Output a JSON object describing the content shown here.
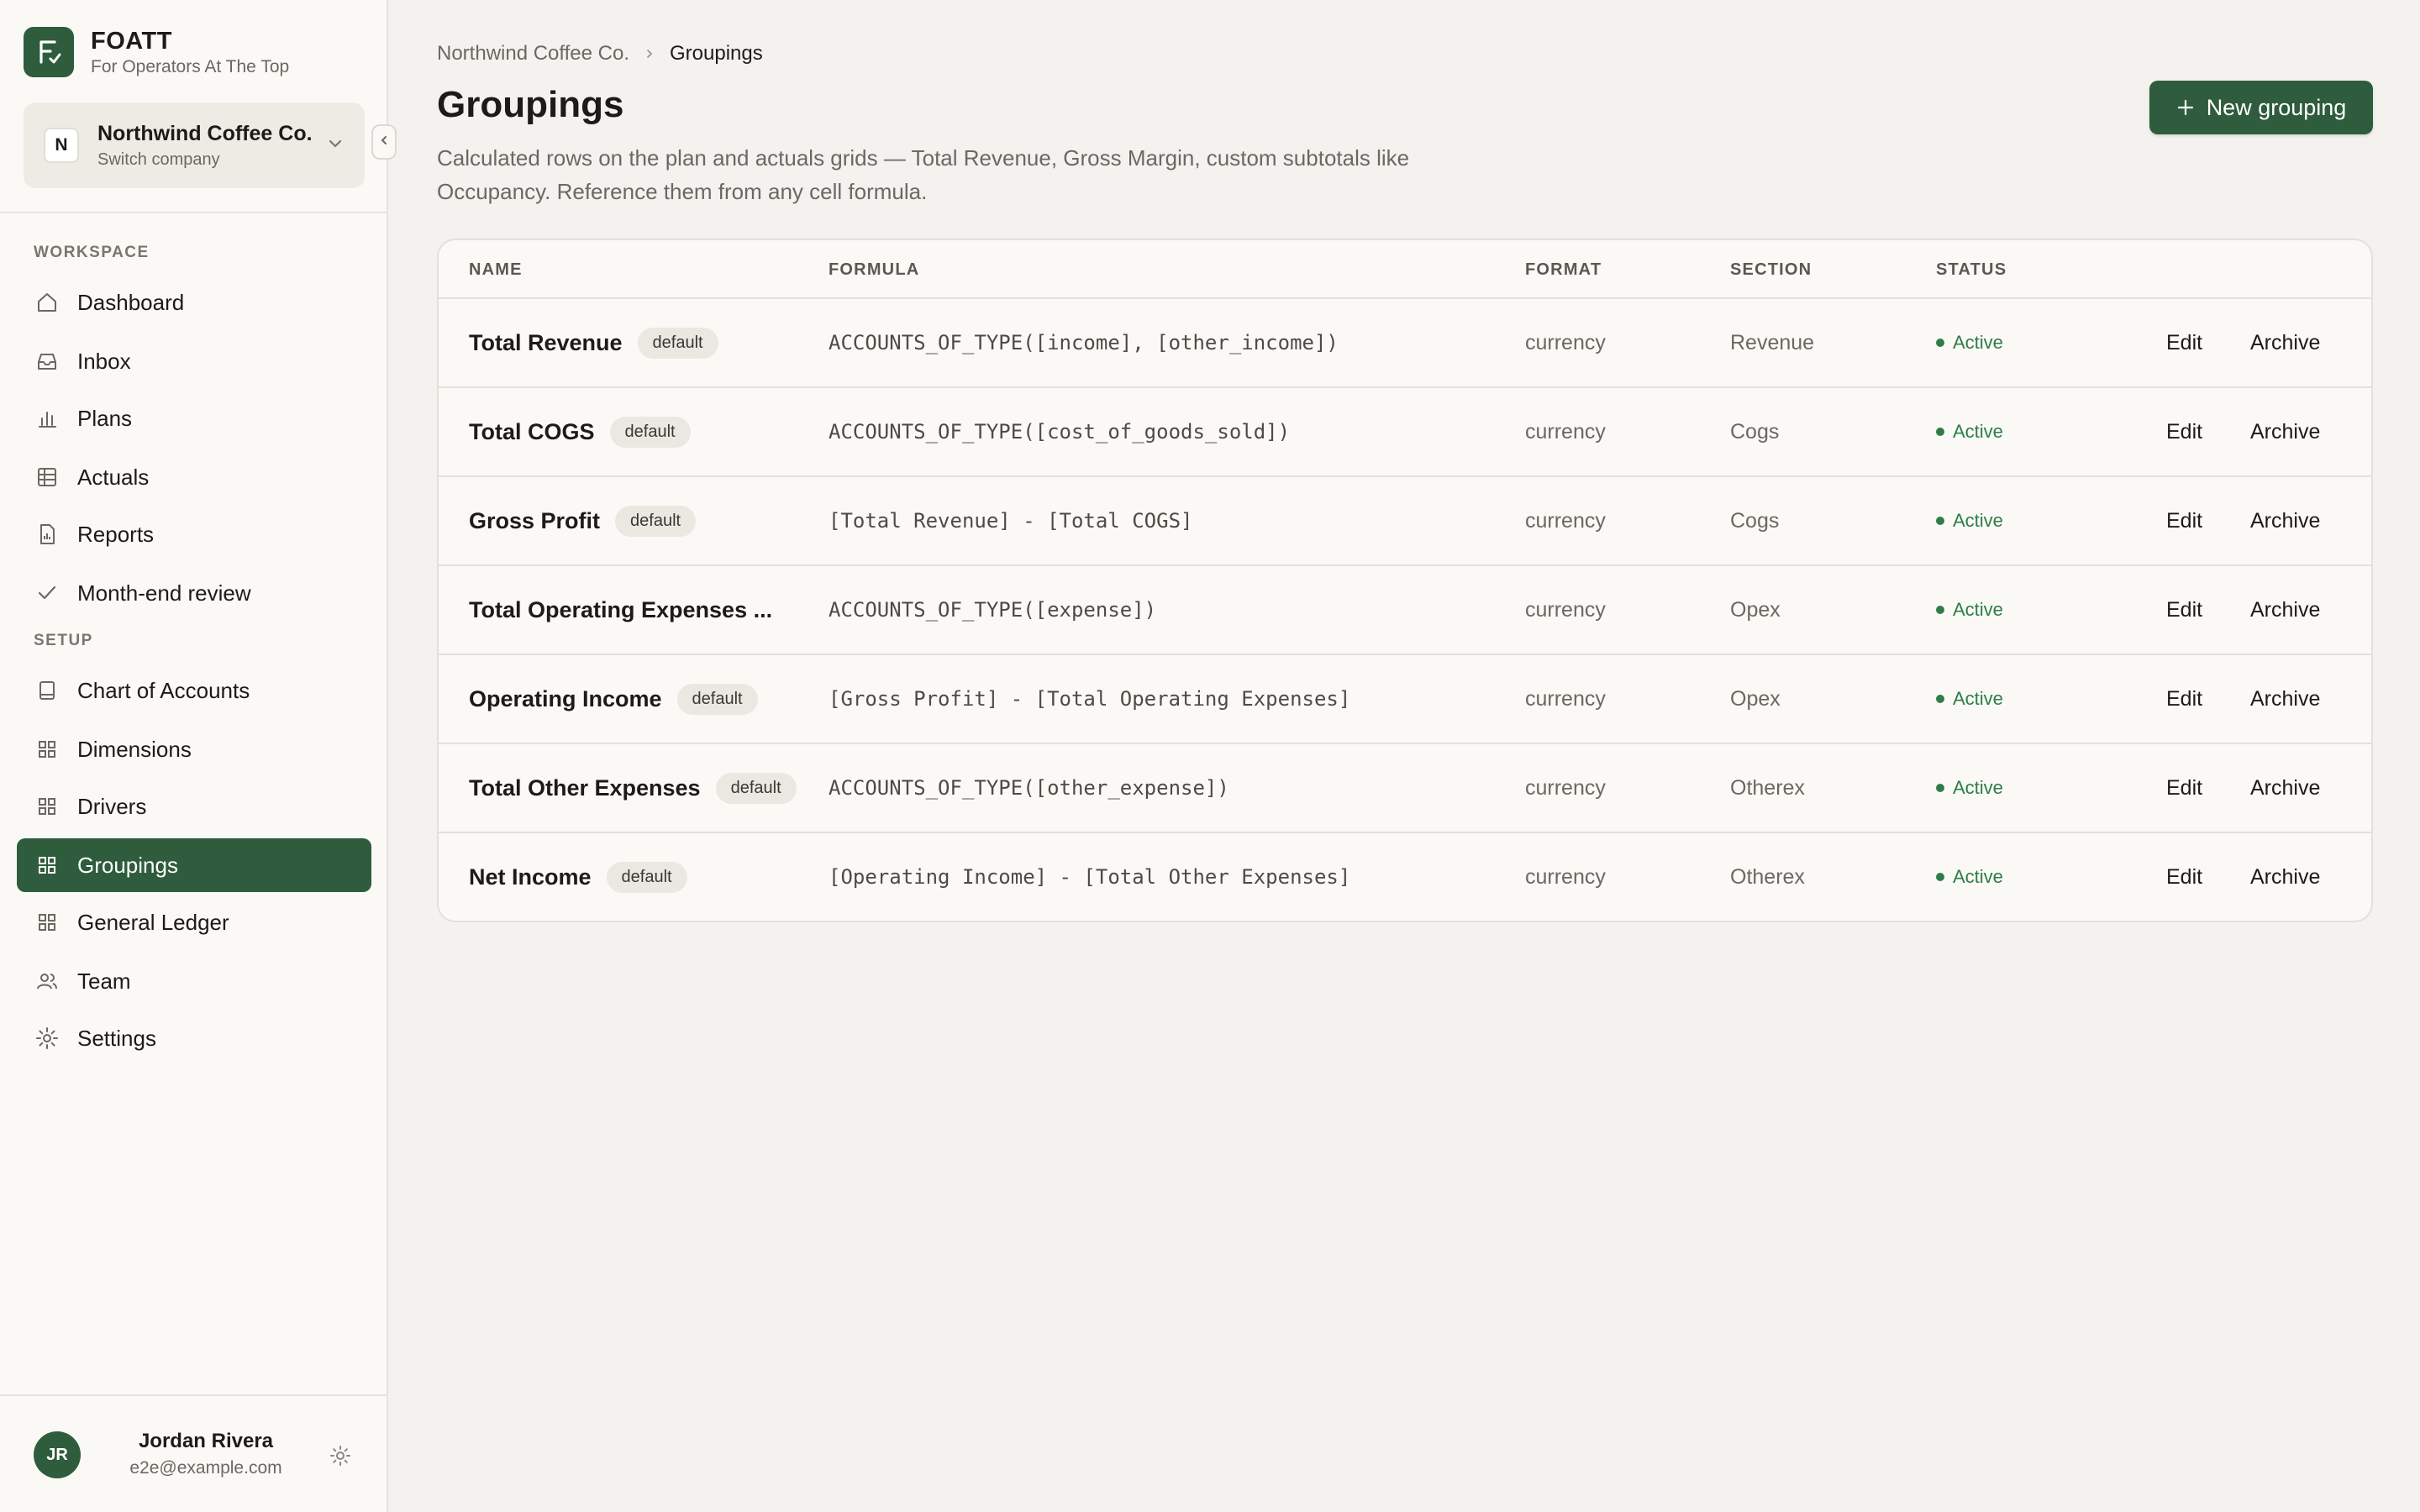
{
  "brand": {
    "name": "FOATT",
    "tagline": "For Operators At The Top"
  },
  "company": {
    "initial": "N",
    "name": "Northwind Coffee Co.",
    "sub": "Switch company"
  },
  "sidebar": {
    "workspace_label": "WORKSPACE",
    "setup_label": "SETUP",
    "workspace_items": [
      {
        "label": "Dashboard",
        "icon": "home-icon"
      },
      {
        "label": "Inbox",
        "icon": "inbox-icon"
      },
      {
        "label": "Plans",
        "icon": "bar-chart-icon"
      },
      {
        "label": "Actuals",
        "icon": "table-icon"
      },
      {
        "label": "Reports",
        "icon": "report-icon"
      },
      {
        "label": "Month-end review",
        "icon": "check-icon"
      }
    ],
    "setup_items": [
      {
        "label": "Chart of Accounts",
        "icon": "ledger-icon"
      },
      {
        "label": "Dimensions",
        "icon": "grid-icon"
      },
      {
        "label": "Drivers",
        "icon": "grid-icon"
      },
      {
        "label": "Groupings",
        "icon": "grid-icon",
        "active": true
      },
      {
        "label": "General Ledger",
        "icon": "grid-icon"
      },
      {
        "label": "Team",
        "icon": "users-icon"
      },
      {
        "label": "Settings",
        "icon": "gear-icon"
      }
    ]
  },
  "user": {
    "initials": "JR",
    "name": "Jordan Rivera",
    "email": "e2e@example.com"
  },
  "breadcrumb": {
    "parent": "Northwind Coffee Co.",
    "current": "Groupings"
  },
  "page": {
    "title": "Groupings",
    "description": "Calculated rows on the plan and actuals grids — Total Revenue, Gross Margin, custom subtotals like Occupancy. Reference them from any cell formula.",
    "new_button": "New grouping"
  },
  "table": {
    "headers": {
      "name": "NAME",
      "formula": "FORMULA",
      "format": "FORMAT",
      "section": "SECTION",
      "status": "STATUS"
    },
    "rows": [
      {
        "name": "Total Revenue",
        "badge": "default",
        "formula": "ACCOUNTS_OF_TYPE([income], [other_income])",
        "format": "currency",
        "section": "Revenue",
        "status": "Active",
        "edit": "Edit",
        "archive": "Archive"
      },
      {
        "name": "Total COGS",
        "badge": "default",
        "formula": "ACCOUNTS_OF_TYPE([cost_of_goods_sold])",
        "format": "currency",
        "section": "Cogs",
        "status": "Active",
        "edit": "Edit",
        "archive": "Archive"
      },
      {
        "name": "Gross Profit",
        "badge": "default",
        "formula": "[Total Revenue] - [Total COGS]",
        "format": "currency",
        "section": "Cogs",
        "status": "Active",
        "edit": "Edit",
        "archive": "Archive"
      },
      {
        "name": "Total Operating Expenses ...",
        "badge": "",
        "formula": "ACCOUNTS_OF_TYPE([expense])",
        "format": "currency",
        "section": "Opex",
        "status": "Active",
        "edit": "Edit",
        "archive": "Archive"
      },
      {
        "name": "Operating Income",
        "badge": "default",
        "formula": "[Gross Profit] - [Total Operating Expenses]",
        "format": "currency",
        "section": "Opex",
        "status": "Active",
        "edit": "Edit",
        "archive": "Archive"
      },
      {
        "name": "Total Other Expenses",
        "badge": "default",
        "formula": "ACCOUNTS_OF_TYPE([other_expense])",
        "format": "currency",
        "section": "Otherex",
        "status": "Active",
        "edit": "Edit",
        "archive": "Archive"
      },
      {
        "name": "Net Income",
        "badge": "default",
        "formula": "[Operating Income] - [Total Other Expenses]",
        "format": "currency",
        "section": "Otherex",
        "status": "Active",
        "edit": "Edit",
        "archive": "Archive"
      }
    ]
  },
  "colors": {
    "accent": "#2e5c3d",
    "active_status": "#2e7d46",
    "background": "#f3f2ee",
    "sidebar": "#faf9f6"
  }
}
